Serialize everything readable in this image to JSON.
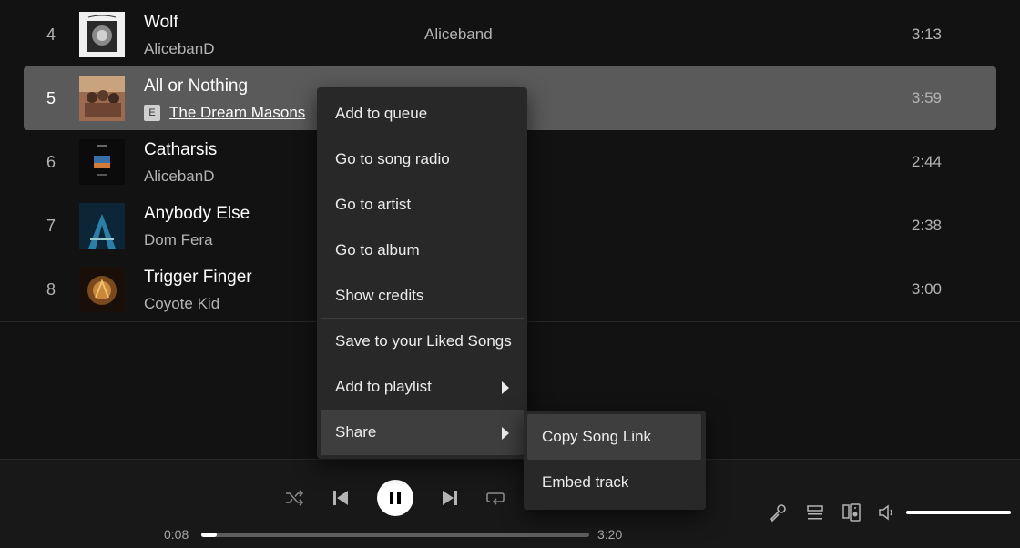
{
  "tracks": [
    {
      "number": "4",
      "title": "Wolf",
      "artist": "AlicebanD",
      "album": "Aliceband",
      "duration": "3:13",
      "explicit": false
    },
    {
      "number": "5",
      "title": "All or Nothing",
      "artist": "The Dream Masons",
      "album": "",
      "duration": "3:59",
      "explicit": true,
      "explicit_label": "E"
    },
    {
      "number": "6",
      "title": "Catharsis",
      "artist": "AlicebanD",
      "album": "",
      "duration": "2:44",
      "explicit": false
    },
    {
      "number": "7",
      "title": "Anybody Else",
      "artist": "Dom Fera",
      "album": "",
      "duration": "2:38",
      "explicit": false
    },
    {
      "number": "8",
      "title": "Trigger Finger",
      "artist": "Coyote Kid",
      "album": "",
      "duration": "3:00",
      "explicit": false
    }
  ],
  "context_menu": {
    "items": [
      {
        "label": "Add to queue"
      },
      {
        "label": "Go to song radio"
      },
      {
        "label": "Go to artist"
      },
      {
        "label": "Go to album"
      },
      {
        "label": "Show credits"
      },
      {
        "label": "Save to your Liked Songs"
      },
      {
        "label": "Add to playlist",
        "has_submenu": true
      },
      {
        "label": "Share",
        "has_submenu": true,
        "active": true
      }
    ]
  },
  "share_submenu": {
    "items": [
      {
        "label": "Copy Song Link",
        "active": true
      },
      {
        "label": "Embed track"
      }
    ]
  },
  "player": {
    "elapsed": "0:08",
    "total": "3:20",
    "progress_fraction": 0.04,
    "volume_fraction": 1.0,
    "icons": [
      "shuffle-icon",
      "previous-icon",
      "pause-icon",
      "next-icon",
      "repeat-icon",
      "lyrics-icon",
      "queue-icon",
      "connect-device-icon",
      "volume-icon"
    ]
  },
  "colors": {
    "background": "#121212",
    "selected_row": "#5a5a5a",
    "menu": "#282828",
    "menu_hover": "#3e3e3e",
    "text_secondary": "#b3b3b3"
  }
}
